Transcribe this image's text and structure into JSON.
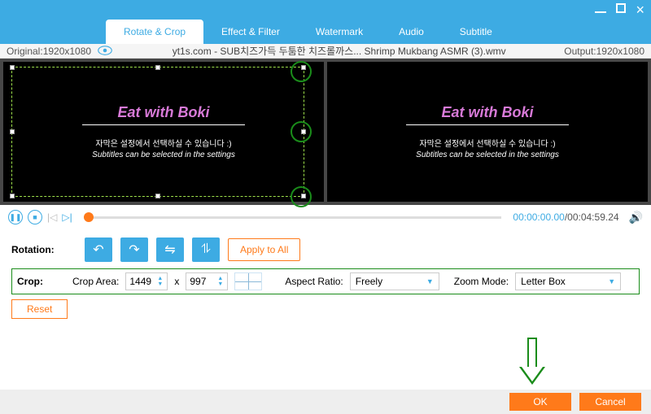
{
  "tabs": {
    "t0": "Rotate & Crop",
    "t1": "Effect & Filter",
    "t2": "Watermark",
    "t3": "Audio",
    "t4": "Subtitle"
  },
  "info": {
    "orig_lbl": "Original: ",
    "orig_val": "1920x1080",
    "filename": "yt1s.com - SUB치즈가득 두툼한 치즈롤까스... Shrimp Mukbang ASMR (3).wmv",
    "out_lbl": "Output: ",
    "out_val": "1920x1080"
  },
  "preview": {
    "title": "Eat with Boki",
    "kor": "자막은 설정에서 선택하실 수 있습니다 :)",
    "eng": "Subtitles can be selected in the settings"
  },
  "time": {
    "cur": "00:00:00.00",
    "sep": "/",
    "tot": "00:04:59.24"
  },
  "rotation": {
    "label": "Rotation:",
    "apply": "Apply to All"
  },
  "crop": {
    "label": "Crop:",
    "area_lbl": "Crop Area:",
    "w": "1449",
    "x": "x",
    "h": "997",
    "aspect_lbl": "Aspect Ratio:",
    "aspect_val": "Freely",
    "zoom_lbl": "Zoom Mode:",
    "zoom_val": "Letter Box",
    "reset": "Reset"
  },
  "footer": {
    "ok": "OK",
    "cancel": "Cancel"
  }
}
